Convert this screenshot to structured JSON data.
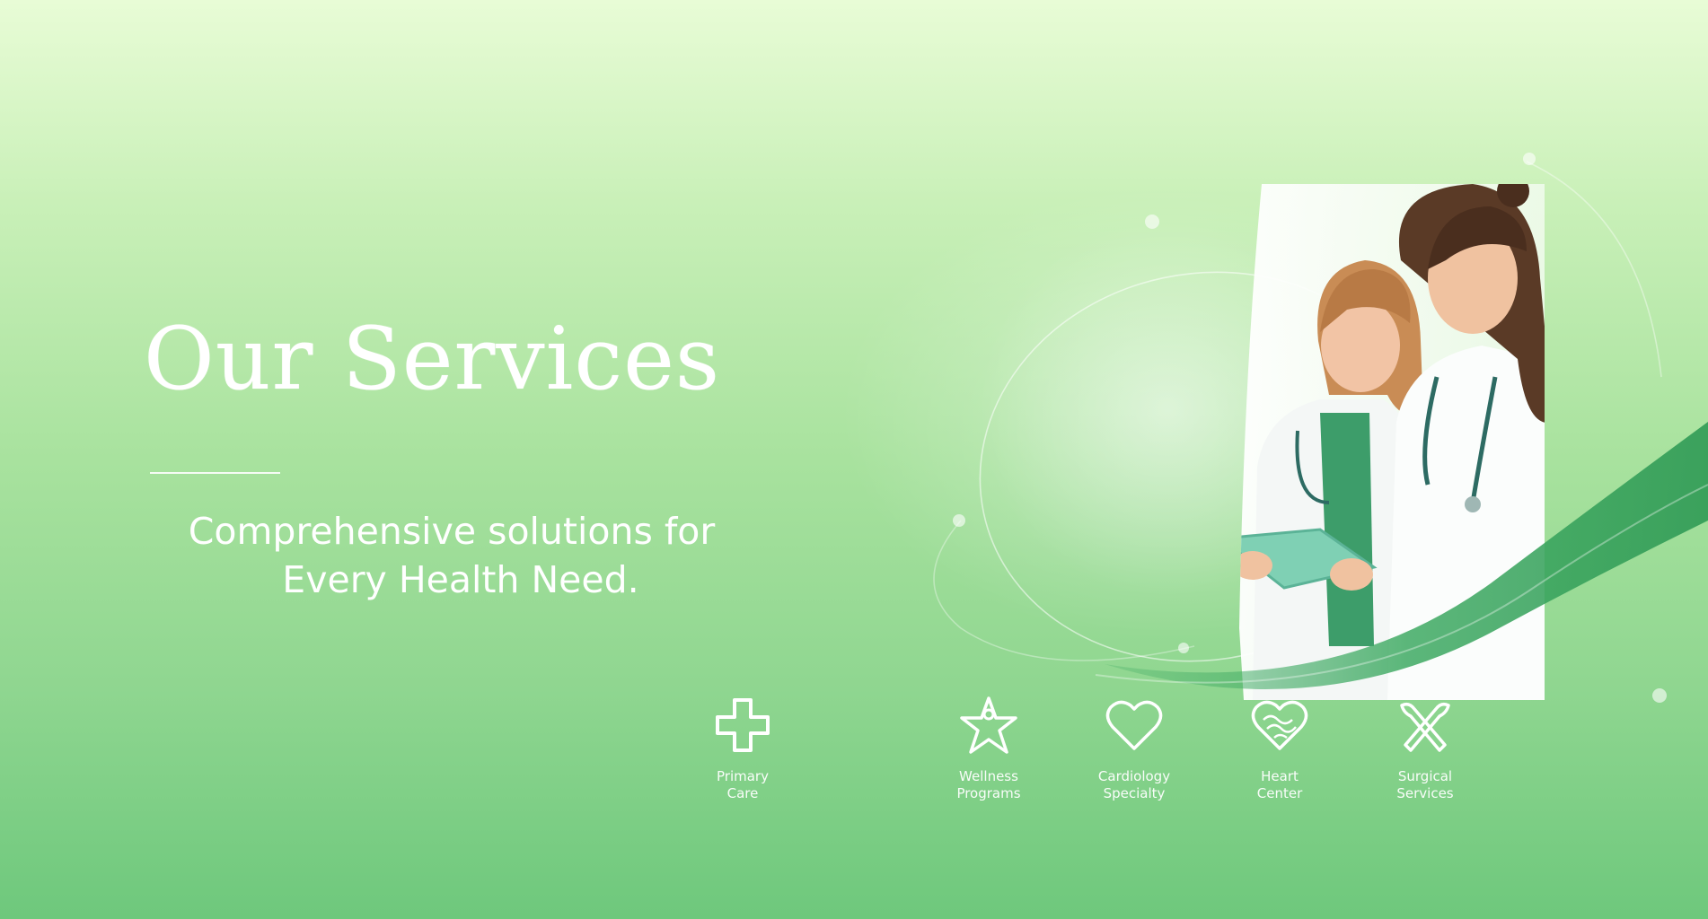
{
  "hero": {
    "title": "Our Services",
    "subtitle_line1": "Comprehensive solutions for",
    "subtitle_line2": "Every Health Need."
  },
  "services": [
    {
      "icon": "medical-cross-icon",
      "label": "Primary\nCare"
    },
    {
      "icon": "star-person-icon",
      "label": "Wellness\nPrograms"
    },
    {
      "icon": "heart-icon",
      "label": "Cardiology\nSpecialty"
    },
    {
      "icon": "heart-pattern-icon",
      "label": "Heart\nCenter"
    },
    {
      "icon": "tools-icon",
      "label": "Surgical\nServices"
    }
  ],
  "colors": {
    "background_top": "#e8fcd6",
    "background_bottom": "#6ec87c",
    "accent_green": "#3faa63",
    "scrub_green": "#3d9d6a",
    "text": "#ffffff"
  }
}
